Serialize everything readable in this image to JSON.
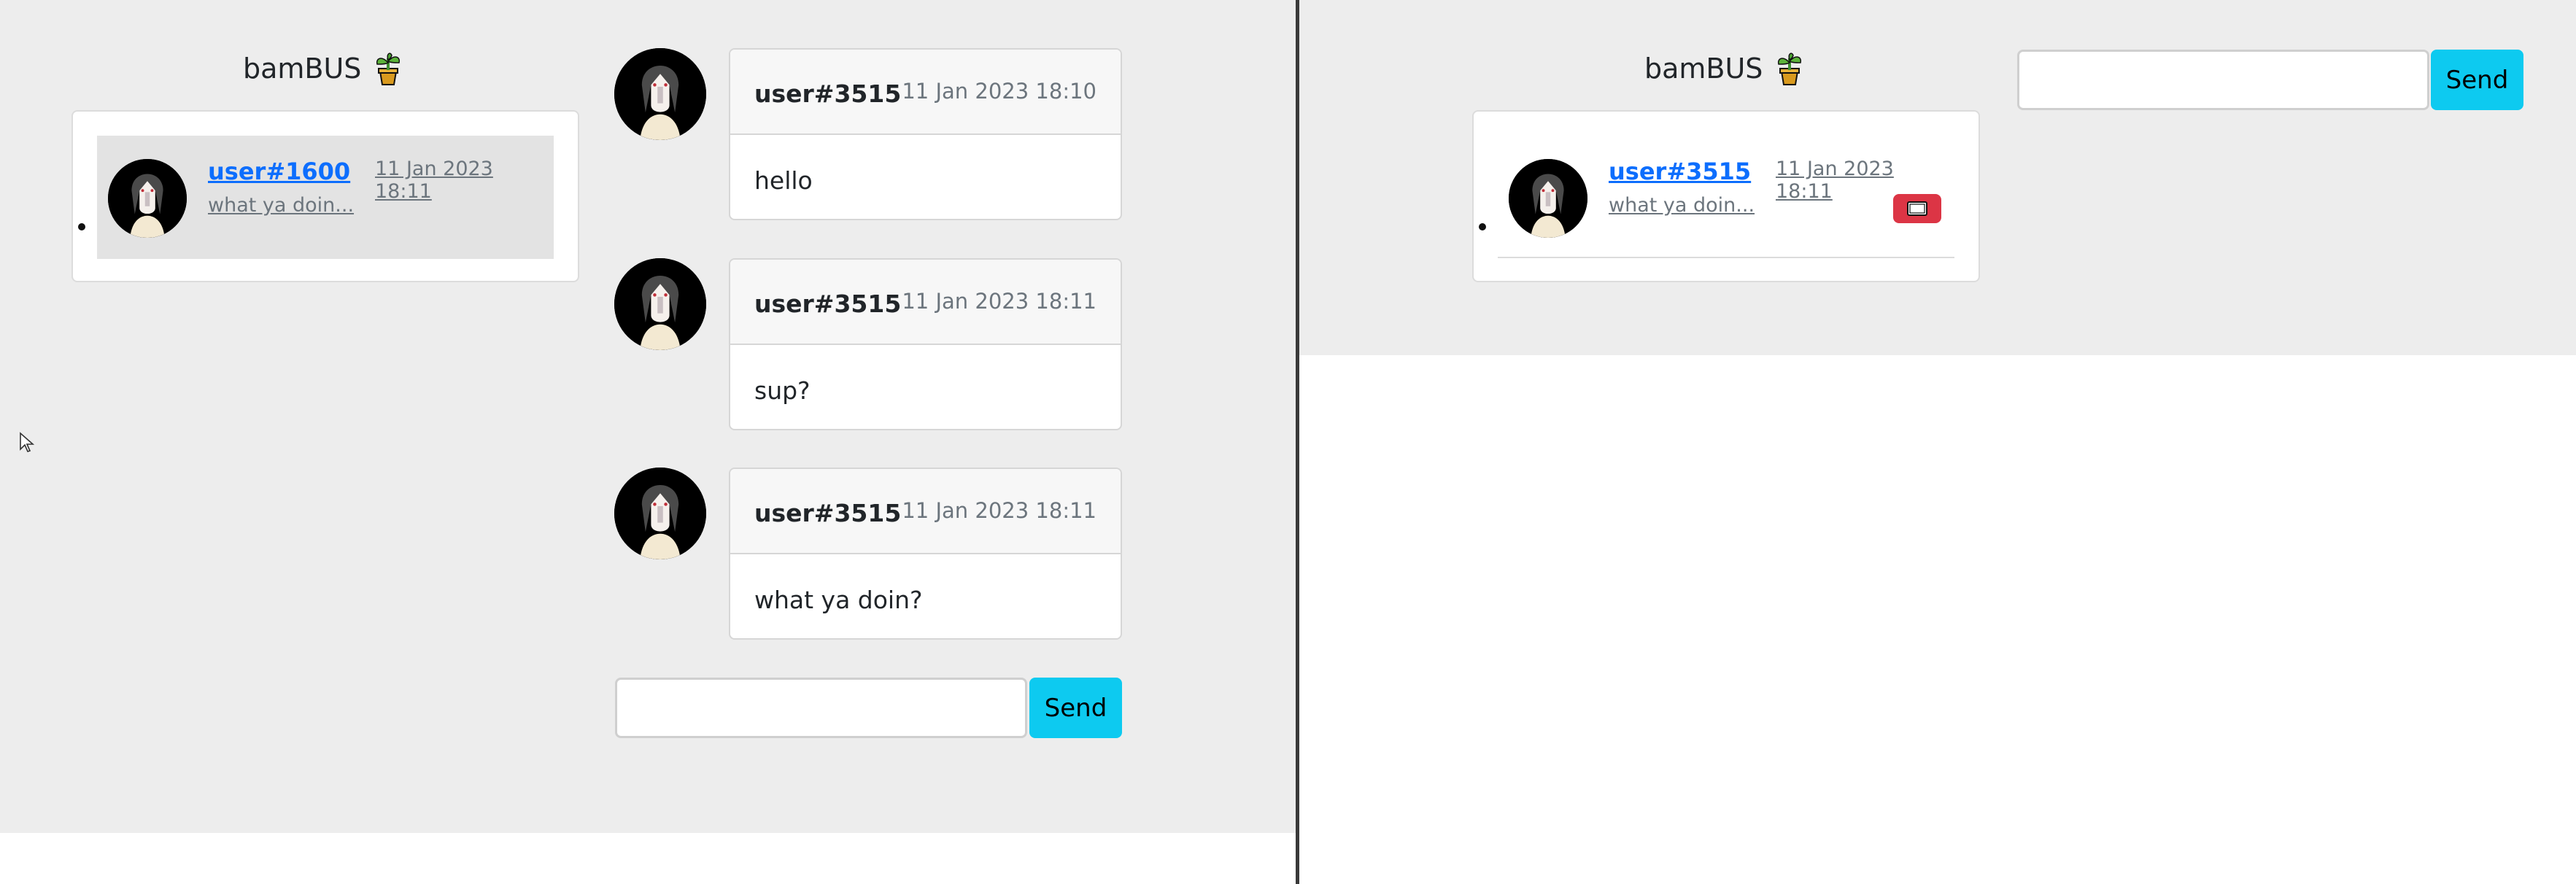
{
  "brand": {
    "name": "bamBUS",
    "icon": "potted-plant-icon"
  },
  "left": {
    "conversations": [
      {
        "user": "user#1600",
        "time": "11 Jan 2023 18:11",
        "preview": "what ya doin..."
      }
    ],
    "messages": [
      {
        "user": "user#3515",
        "time": "11 Jan 2023 18:10",
        "text": "hello"
      },
      {
        "user": "user#3515",
        "time": "11 Jan 2023 18:11",
        "text": "sup?"
      },
      {
        "user": "user#3515",
        "time": "11 Jan 2023 18:11",
        "text": "what ya doin?"
      }
    ],
    "composer": {
      "value": "",
      "send_label": "Send"
    }
  },
  "right": {
    "conversations": [
      {
        "user": "user#3515",
        "time": "11 Jan 2023 18:11",
        "preview": "what ya doin...",
        "unread_icon": "envelope-icon"
      }
    ],
    "composer": {
      "value": "",
      "send_label": "Send"
    }
  },
  "colors": {
    "accent": "#0dcaf0",
    "link": "#0d6efd",
    "badge": "#dc3545",
    "background": "#ededed"
  }
}
